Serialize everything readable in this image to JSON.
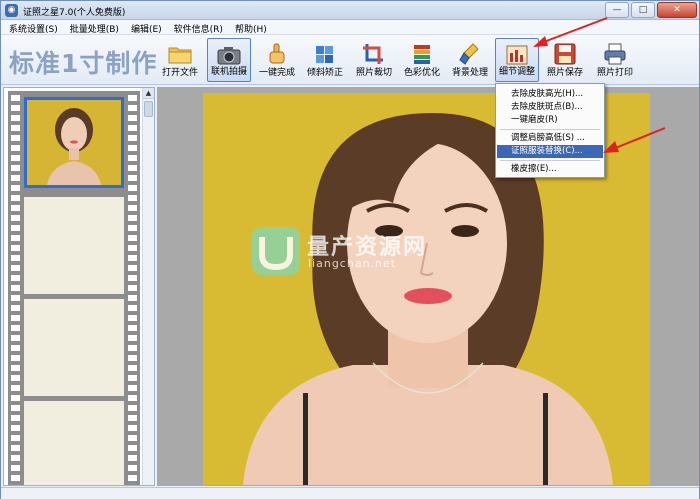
{
  "window": {
    "title": "证照之星7.0(个人免费版)",
    "controls": [
      "—",
      "□",
      "✕"
    ]
  },
  "menu": [
    "系统设置(S)",
    "批量处理(B)",
    "编辑(E)",
    "软件信息(R)",
    "帮助(H)"
  ],
  "toolbar": {
    "brand": "标准1寸制作",
    "tools": [
      {
        "label": "打开文件",
        "icon": "folder-icon"
      },
      {
        "label": "联机拍摄",
        "icon": "camera-icon",
        "selected": true
      },
      {
        "label": "一键完成",
        "icon": "hand-pointer-icon"
      },
      {
        "label": "倾斜矫正",
        "icon": "puzzle-icon"
      },
      {
        "label": "照片裁切",
        "icon": "crop-icon"
      },
      {
        "label": "色彩优化",
        "icon": "color-bars-icon"
      },
      {
        "label": "背景处理",
        "icon": "brush-icon"
      },
      {
        "label": "细节调整",
        "icon": "detail-icon",
        "selected": true
      },
      {
        "label": "照片保存",
        "icon": "floppy-disk-icon"
      },
      {
        "label": "照片打印",
        "icon": "printer-icon"
      }
    ]
  },
  "dropdown": {
    "items": [
      {
        "label": "去除皮肤高光(H)..."
      },
      {
        "label": "去除皮肤斑点(B)..."
      },
      {
        "label": "一键磨皮(R)"
      },
      {
        "label": "调整肩膀高低(S) ..."
      },
      {
        "label": "证照服装替换(C)...",
        "highlighted": true
      },
      {
        "label": "橡皮擦(E)..."
      }
    ]
  },
  "watermark": {
    "title": "量产资源网",
    "url": "liangchan.net"
  },
  "colors": {
    "accent_blue": "#3b67b4",
    "photo_background": "#d7ba34",
    "canvas_gray": "#a9a9a9",
    "arrow_red": "#e0211f",
    "brand_text": "#8ba2c4"
  }
}
